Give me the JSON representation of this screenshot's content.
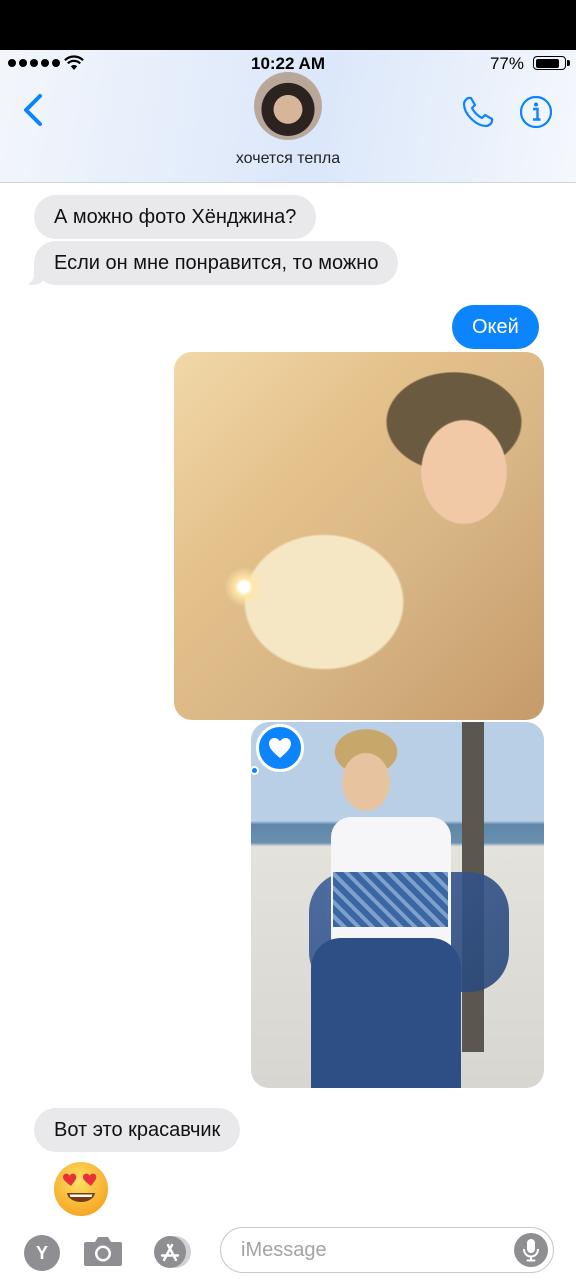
{
  "status_bar": {
    "time": "10:22 AM",
    "battery": "77%",
    "battery_level": 0.77
  },
  "header": {
    "contact_name": "хочется тепла"
  },
  "messages": [
    {
      "direction": "incoming",
      "text": "А можно фото Хёнджина?"
    },
    {
      "direction": "incoming",
      "text": "Если он мне понравится, то можно"
    },
    {
      "direction": "outgoing",
      "text": "Окей"
    },
    {
      "direction": "outgoing",
      "type": "photo"
    },
    {
      "direction": "outgoing",
      "type": "photo",
      "reaction": "heart-icon"
    },
    {
      "direction": "incoming",
      "text": "Вот это красавчик"
    },
    {
      "direction": "incoming",
      "type": "emoji",
      "emoji": "😍"
    }
  ],
  "composer": {
    "apps_letter": "Y",
    "placeholder": "iMessage"
  },
  "colors": {
    "accent": "#0b84fe",
    "incoming_bubble": "#e9e9eb",
    "outgoing_bubble": "#0b84fe"
  },
  "icons": [
    "back-chevron-icon",
    "phone-icon",
    "info-icon",
    "heart-icon",
    "camera-icon",
    "app-store-icon",
    "microphone-icon"
  ]
}
